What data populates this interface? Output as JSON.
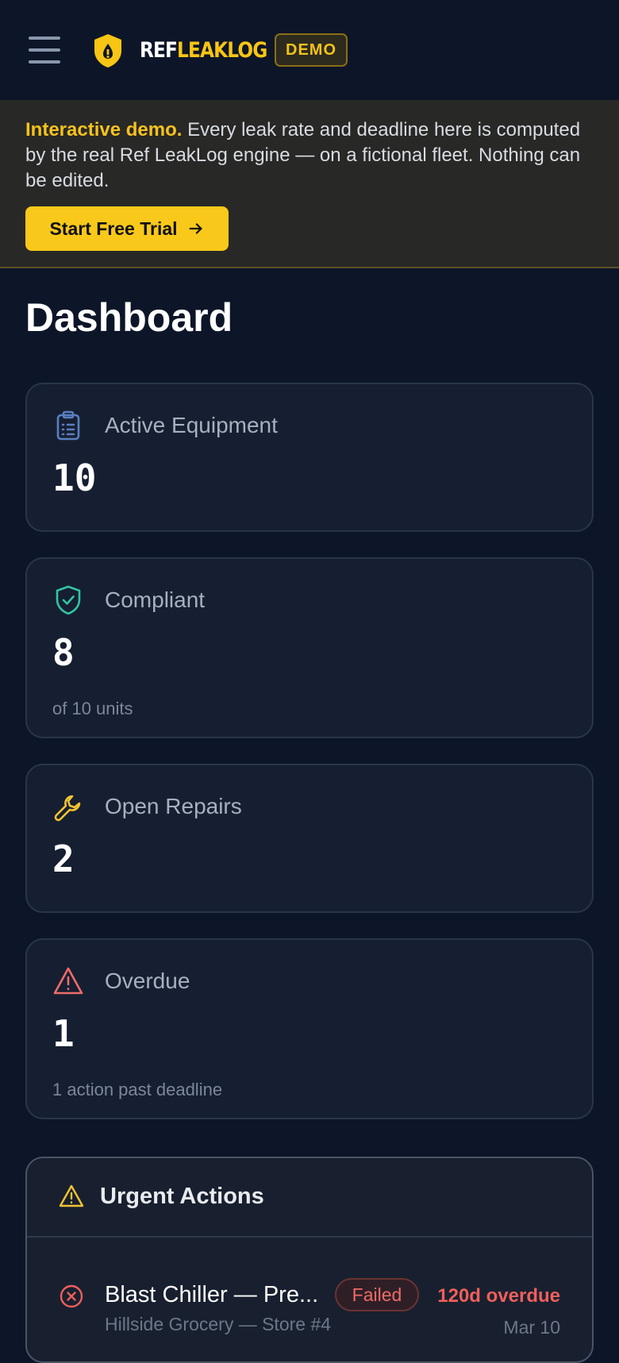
{
  "header": {
    "logo_ref": "REF",
    "logo_leak": "LEAKLOG",
    "badge": "DEMO"
  },
  "banner": {
    "highlight": "Interactive demo.",
    "text": " Every leak rate and deadline here is computed by the real Ref LeakLog engine — on a fictional fleet. Nothing can be edited.",
    "cta": "Start Free Trial"
  },
  "page_title": "Dashboard",
  "cards": [
    {
      "icon": "clipboard-list-icon",
      "label": "Active Equipment",
      "value": "10",
      "sub": ""
    },
    {
      "icon": "shield-check-icon",
      "label": "Compliant",
      "value": "8",
      "sub": "of 10 units"
    },
    {
      "icon": "wrench-icon",
      "label": "Open Repairs",
      "value": "2",
      "sub": ""
    },
    {
      "icon": "alert-triangle-icon",
      "label": "Overdue",
      "value": "1",
      "sub": "1 action past deadline"
    }
  ],
  "urgent": {
    "title": "Urgent Actions",
    "items": [
      {
        "name": "Blast Chiller — Pre...",
        "status": "Failed",
        "overdue": "120d overdue",
        "store": "Hillside Grocery — Store #4",
        "date": "Mar 10"
      }
    ]
  },
  "colors": {
    "background": "#0d1628",
    "card": "#161f31",
    "accent_yellow": "#f8c91a",
    "danger_red": "#ef5f5b",
    "success_green": "#34c3a0",
    "info_blue": "#5a7fc0"
  }
}
